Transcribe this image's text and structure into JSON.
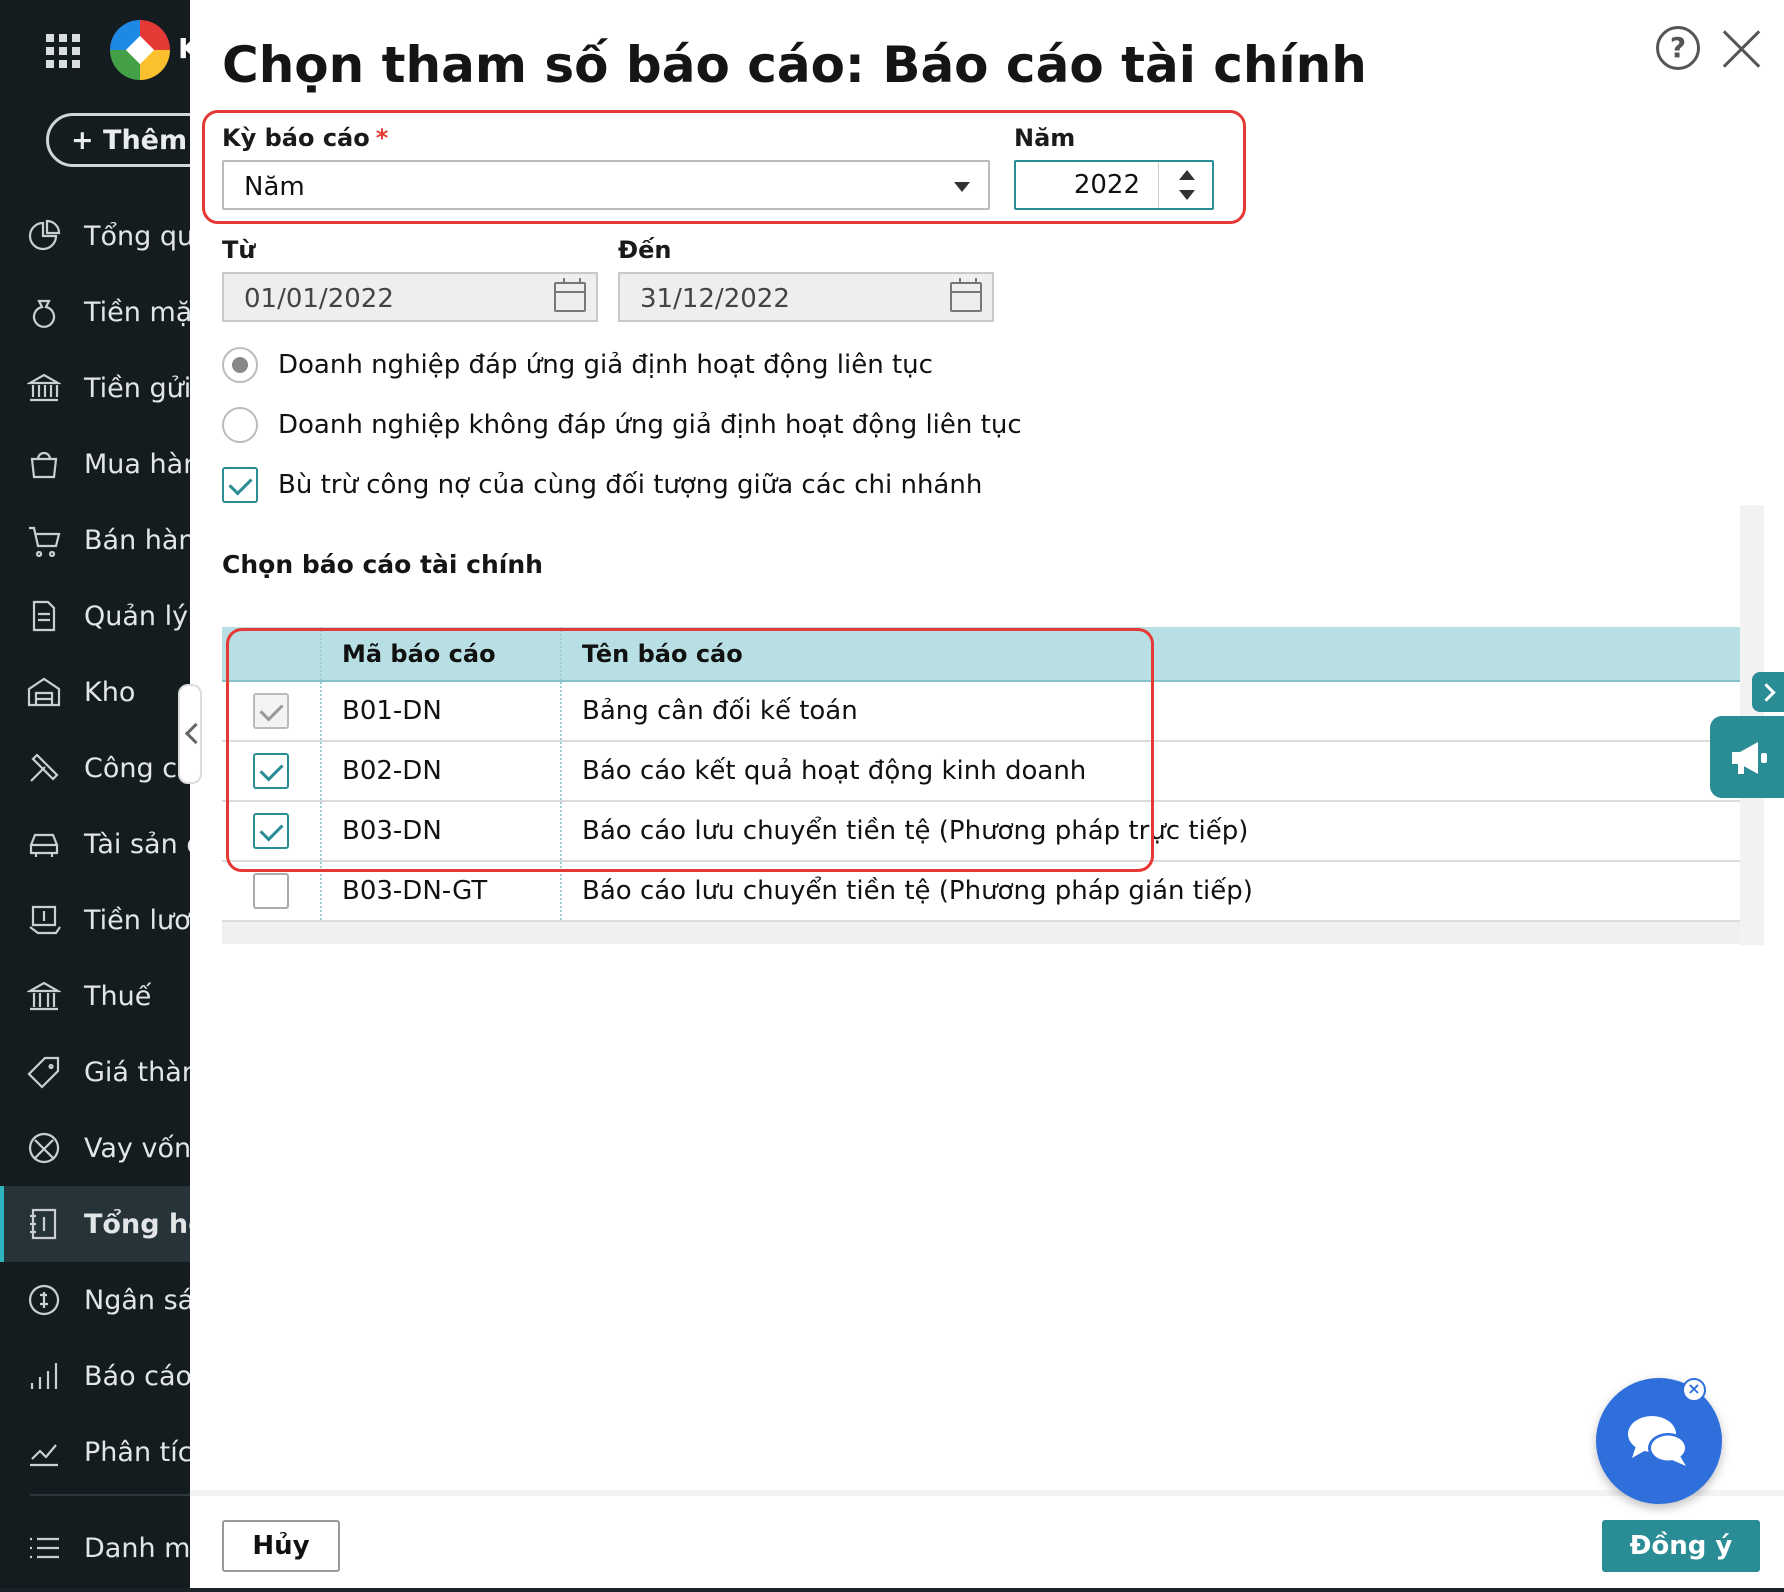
{
  "sidebar": {
    "logo_letter": "K",
    "add_button": "+ Thêm m",
    "items": [
      {
        "label": "Tổng qua",
        "icon": "pie-chart-icon"
      },
      {
        "label": "Tiền mặt",
        "icon": "money-bag-icon"
      },
      {
        "label": "Tiền gửi",
        "icon": "bank-icon"
      },
      {
        "label": "Mua hàn",
        "icon": "shopping-bag-icon"
      },
      {
        "label": "Bán hàng",
        "icon": "cart-icon"
      },
      {
        "label": "Quản lý h",
        "icon": "invoice-icon"
      },
      {
        "label": "Kho",
        "icon": "warehouse-icon"
      },
      {
        "label": "Công cụ",
        "icon": "tools-icon"
      },
      {
        "label": "Tài sản c",
        "icon": "car-icon"
      },
      {
        "label": "Tiền lươn",
        "icon": "salary-icon"
      },
      {
        "label": "Thuế",
        "icon": "tax-icon"
      },
      {
        "label": "Giá thàn",
        "icon": "price-tag-icon"
      },
      {
        "label": "Vay vốn",
        "icon": "loan-icon"
      },
      {
        "label": "Tổng hợ",
        "icon": "ledger-icon"
      },
      {
        "label": "Ngân sác",
        "icon": "budget-icon"
      },
      {
        "label": "Báo cáo",
        "icon": "bar-chart-icon"
      },
      {
        "label": "Phân tích",
        "icon": "analytics-icon"
      },
      {
        "label": "Danh mụ",
        "icon": "list-icon"
      }
    ],
    "active_index": 13
  },
  "dialog": {
    "title": "Chọn tham số báo cáo: Báo cáo tài chính",
    "period_label": "Kỳ báo cáo",
    "required_mark": "*",
    "period_value": "Năm",
    "year_label": "Năm",
    "year_value": "2022",
    "from_label": "Từ",
    "from_value": "01/01/2022",
    "to_label": "Đến",
    "to_value": "31/12/2022",
    "radio_going_concern": "Doanh nghiệp đáp ứng giả định hoạt động liên tục",
    "radio_not_going_concern": "Doanh nghiệp không đáp ứng giả định hoạt động liên tục",
    "offset_checkbox": "Bù trừ công nợ của cùng đối tượng giữa các chi nhánh",
    "section_title": "Chọn báo cáo tài chính",
    "table": {
      "headers": [
        "",
        "Mã báo cáo",
        "Tên báo cáo"
      ],
      "rows": [
        {
          "code": "B01-DN",
          "name": "Bảng cân đối kế toán",
          "state": "disabled"
        },
        {
          "code": "B02-DN",
          "name": "Báo cáo kết quả hoạt động kinh doanh",
          "state": "on"
        },
        {
          "code": "B03-DN",
          "name": "Báo cáo lưu chuyển tiền tệ (Phương pháp trực tiếp)",
          "state": "on"
        },
        {
          "code": "B03-DN-GT",
          "name": "Báo cáo lưu chuyển tiền tệ (Phương pháp gián tiếp)",
          "state": "off"
        }
      ]
    },
    "cancel_button": "Hủy",
    "ok_button": "Đồng ý",
    "help_symbol": "?",
    "chat_close": "×"
  },
  "colors": {
    "accent": "#2a8c94",
    "highlight": "#e53935",
    "table_header": "#b8e0e4",
    "chat": "#2f6fdc",
    "sidebar": "#151c20"
  }
}
